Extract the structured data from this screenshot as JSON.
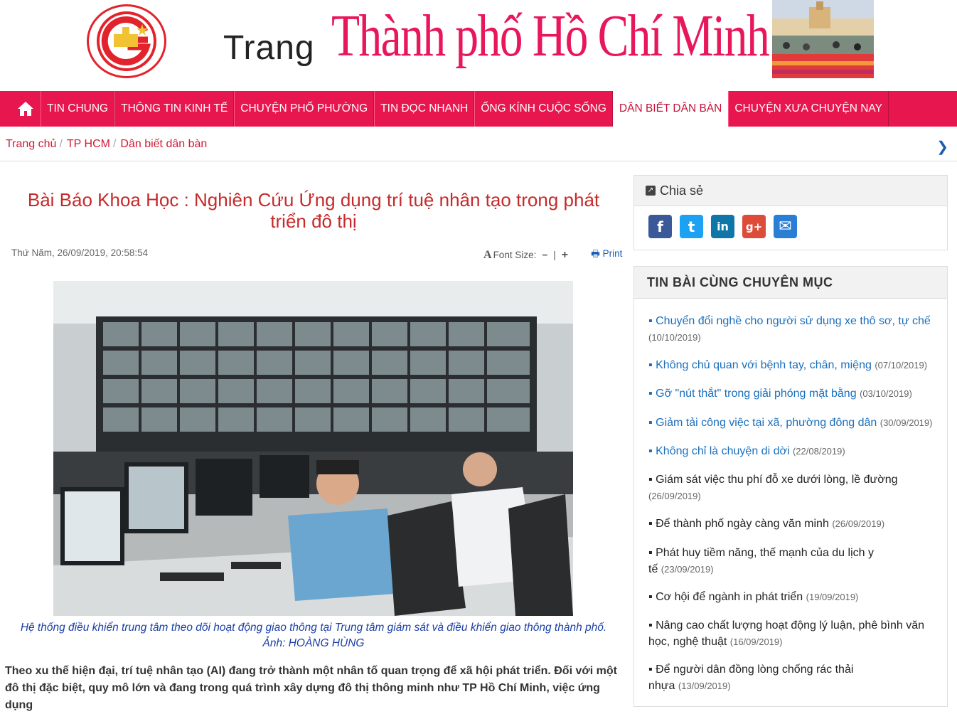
{
  "header": {
    "trang": "Trang",
    "city": "Thành phố Hồ Chí Minh"
  },
  "nav": {
    "home_icon": "home-icon",
    "items": [
      {
        "label": "TIN CHUNG",
        "active": false
      },
      {
        "label": "THÔNG TIN KINH TẾ",
        "active": false
      },
      {
        "label": "CHUYỆN PHỐ PHƯỜNG",
        "active": false
      },
      {
        "label": "TIN ĐỌC NHANH",
        "active": false
      },
      {
        "label": "ỐNG KÍNH CUỘC SỐNG",
        "active": false
      },
      {
        "label": "DÂN BIẾT DÂN BÀN",
        "active": true
      },
      {
        "label": "CHUYỆN XƯA CHUYỆN NAY",
        "active": false
      }
    ]
  },
  "breadcrumb": {
    "items": [
      "Trang chủ",
      "TP HCM",
      "Dân biết dân bàn"
    ],
    "sep": "/"
  },
  "article": {
    "title": "Bài Báo Khoa Học : Nghiên Cứu Ứng dụng trí tuệ nhân tạo trong phát triển đô thị",
    "date": "Thứ Năm, 26/09/2019, 20:58:54",
    "font_size_label": "Font Size:",
    "minus": "−",
    "bar": "|",
    "plus": "+",
    "print_label": "Print",
    "caption": "Hệ thống điều khiển trung tâm theo dõi hoạt động giao thông tại Trung tâm giám sát và điều khiển giao thông thành phố. Ảnh: HOÀNG HÙNG",
    "lead": "Theo xu thế hiện đại, trí tuệ nhân tạo (AI) đang trở thành một nhân tố quan trọng để xã hội phát triển. Đối với một đô thị đặc biệt, quy mô lớn và đang trong quá trình xây dựng đô thị thông minh như TP Hồ Chí Minh, việc ứng dụng"
  },
  "share": {
    "title": "Chia sẻ",
    "icons": [
      {
        "name": "facebook-icon",
        "glyph": "f",
        "color": "#3b5998"
      },
      {
        "name": "twitter-icon",
        "glyph": "t",
        "color": "#1da1f2"
      },
      {
        "name": "linkedin-icon",
        "glyph": "in",
        "color": "#0e76a8"
      },
      {
        "name": "googleplus-icon",
        "glyph": "g+",
        "color": "#dd4b39"
      },
      {
        "name": "email-icon",
        "glyph": "✉",
        "color": "#2a7fd4"
      }
    ]
  },
  "related": {
    "title": "TIN BÀI CÙNG CHUYÊN MỤC",
    "items": [
      {
        "title": "Chuyển đổi nghề cho người sử dụng xe thô sơ, tự chế",
        "date": "(10/10/2019)",
        "style": "blue"
      },
      {
        "title": "Không chủ quan với bệnh tay, chân, miệng",
        "date": "(07/10/2019)",
        "style": "blue"
      },
      {
        "title": "Gỡ \"nút thắt\" trong giải phóng mặt bằng",
        "date": "(03/10/2019)",
        "style": "blue"
      },
      {
        "title": "Giảm tải công việc tại xã, phường đông dân",
        "date": "(30/09/2019)",
        "style": "blue"
      },
      {
        "title": "Không chỉ là chuyện di dời",
        "date": "(22/08/2019)",
        "style": "blue"
      },
      {
        "title": "Giám sát việc thu phí đỗ xe dưới lòng, lề đường",
        "date": "(26/09/2019)",
        "style": "dark"
      },
      {
        "title": "Để thành phố ngày càng văn minh",
        "date": "(26/09/2019)",
        "style": "dark"
      },
      {
        "title": "Phát huy tiềm năng, thế mạnh của du lịch y tế",
        "date": "(23/09/2019)",
        "style": "dark"
      },
      {
        "title": "Cơ hội để ngành in phát triển",
        "date": "(19/09/2019)",
        "style": "dark"
      },
      {
        "title": "Nâng cao chất lượng hoạt động lý luận, phê bình văn học, nghệ thuật",
        "date": "(16/09/2019)",
        "style": "dark"
      },
      {
        "title": "Để người dân đồng lòng chống rác thải nhựa",
        "date": "(13/09/2019)",
        "style": "dark"
      }
    ]
  }
}
